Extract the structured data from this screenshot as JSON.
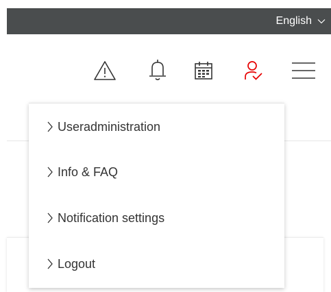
{
  "language_bar": {
    "selected_language": "English",
    "background_color": "#4a4d4e"
  },
  "header": {
    "icons": [
      {
        "name": "warning-icon",
        "color": "#333333"
      },
      {
        "name": "bell-icon",
        "color": "#333333"
      },
      {
        "name": "calendar-icon",
        "color": "#333333"
      },
      {
        "name": "user-check-icon",
        "color": "#e60000"
      },
      {
        "name": "hamburger-menu-icon",
        "color": "#333333"
      }
    ]
  },
  "user_menu": {
    "items": [
      {
        "label": "Useradministration"
      },
      {
        "label": "Info & FAQ"
      },
      {
        "label": "Notification settings"
      },
      {
        "label": "Logout"
      }
    ]
  },
  "colors": {
    "accent": "#e60000",
    "text": "#333333"
  }
}
